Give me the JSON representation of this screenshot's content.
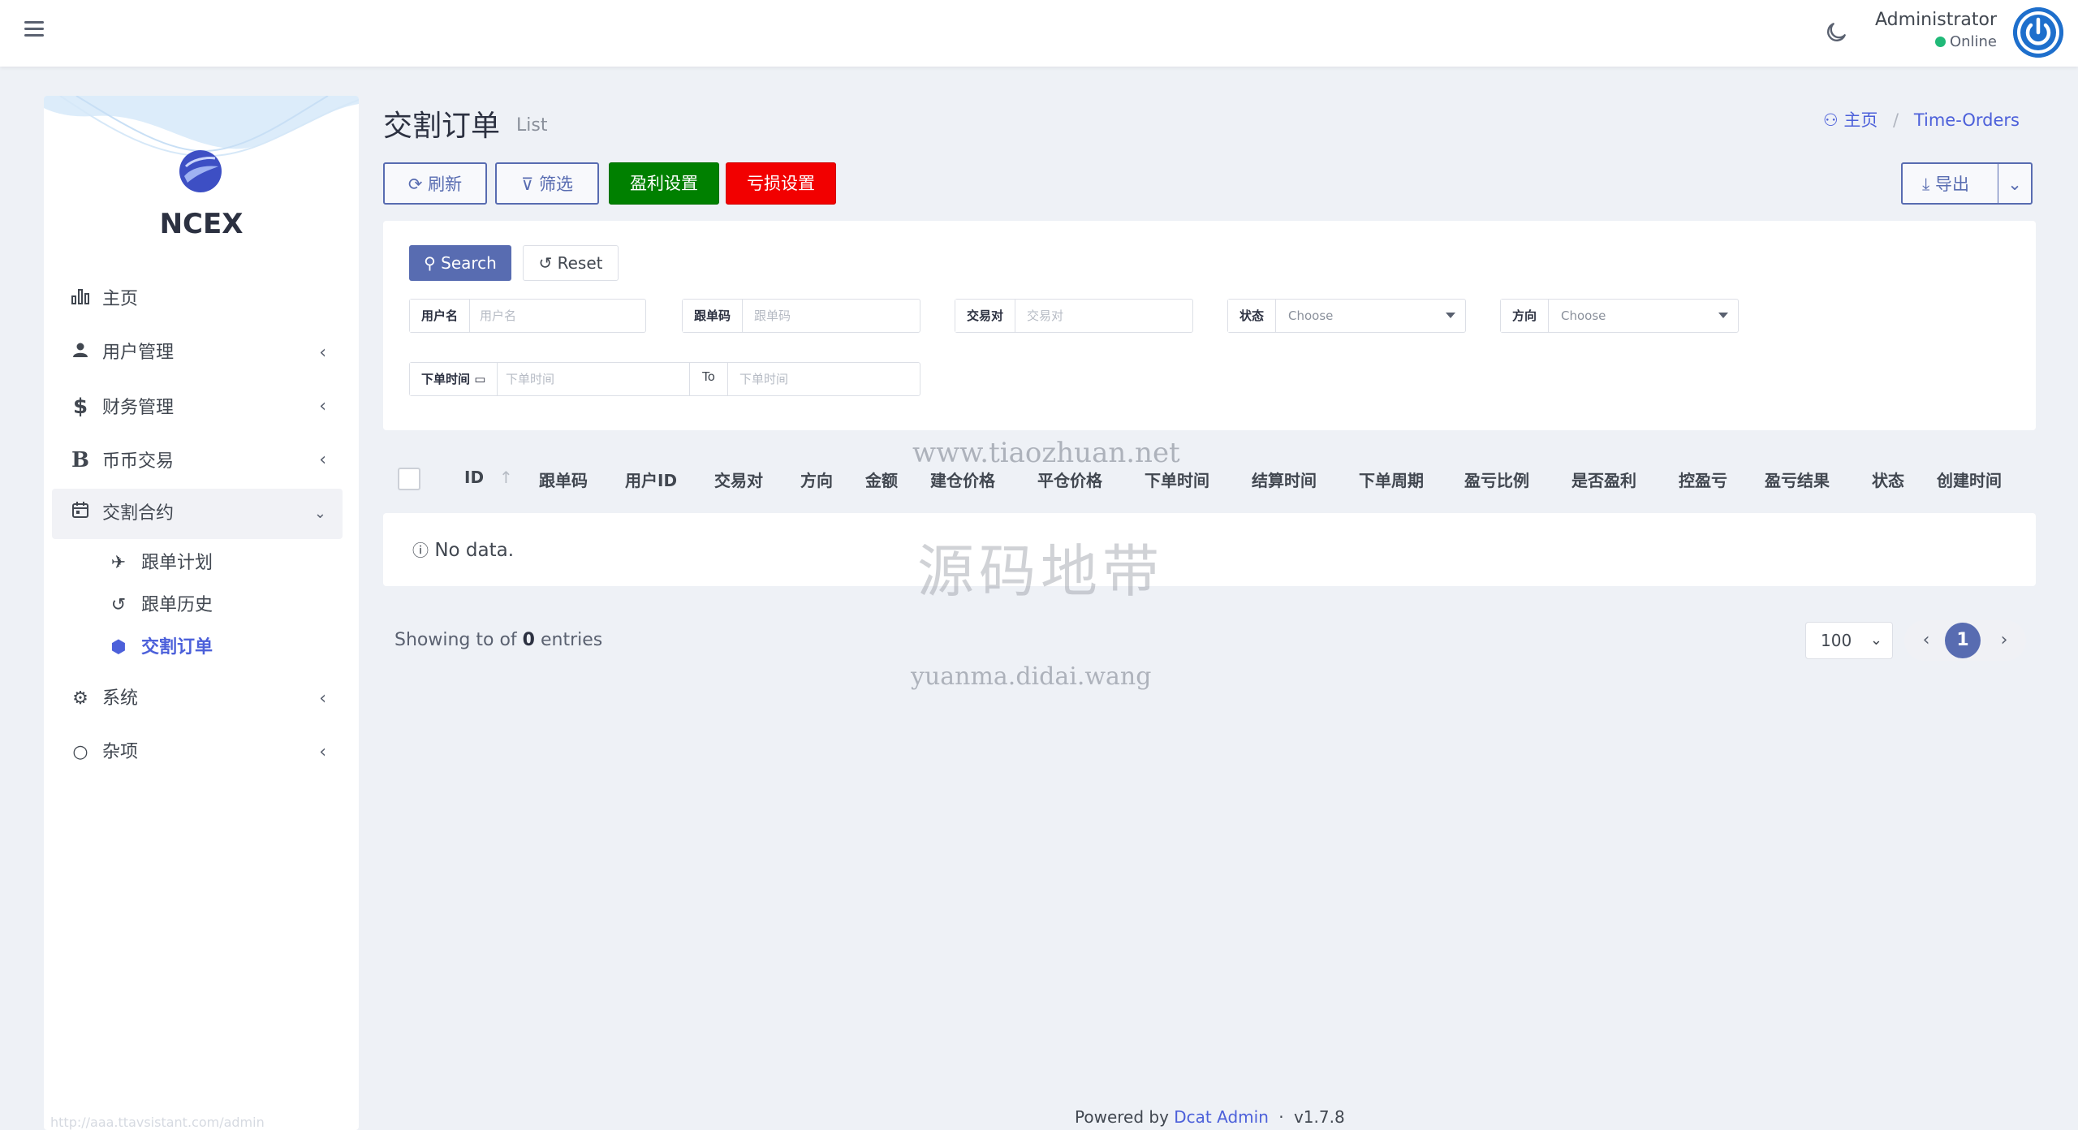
{
  "header": {
    "user_name": "Administrator",
    "user_status": "Online",
    "status_color": "#21b978"
  },
  "sidebar": {
    "brand": "NCEX",
    "items": [
      {
        "label": "主页",
        "icon": "bar-chart-icon"
      },
      {
        "label": "用户管理",
        "icon": "users-icon"
      },
      {
        "label": "财务管理",
        "icon": "dollar-icon"
      },
      {
        "label": "币币交易",
        "icon": "bitcoin-icon"
      },
      {
        "label": "交割合约",
        "icon": "calendar-icon"
      },
      {
        "label": "系统",
        "icon": "gear-icon"
      },
      {
        "label": "杂项",
        "icon": "circle-icon"
      }
    ],
    "subitems": [
      {
        "label": "跟单计划",
        "icon": "plane-icon"
      },
      {
        "label": "跟单历史",
        "icon": "history-icon"
      },
      {
        "label": "交割订单",
        "icon": "hexagon-icon"
      }
    ],
    "footer_url": "http://aaa.ttavsistant.com/admin"
  },
  "page": {
    "title": "交割订单",
    "subtitle": "List",
    "breadcrumb_home": "主页",
    "breadcrumb_current": "Time-Orders"
  },
  "toolbar": {
    "refresh": "刷新",
    "filter": "筛选",
    "profit_settings": "盈利设置",
    "loss_settings": "亏损设置",
    "export": "导出"
  },
  "filter": {
    "search": "Search",
    "reset": "Reset",
    "fields": {
      "username": {
        "label": "用户名",
        "placeholder": "用户名"
      },
      "follow_code": {
        "label": "跟单码",
        "placeholder": "跟单码"
      },
      "pair": {
        "label": "交易对",
        "placeholder": "交易对"
      },
      "status": {
        "label": "状态",
        "value": "Choose"
      },
      "direction": {
        "label": "方向",
        "value": "Choose"
      },
      "order_time": {
        "label": "下单时间",
        "placeholder_from": "下单时间",
        "to": "To",
        "placeholder_to": "下单时间"
      }
    }
  },
  "table": {
    "columns": [
      "ID",
      "跟单码",
      "用户ID",
      "交易对",
      "方向",
      "金额",
      "建仓价格",
      "平仓价格",
      "下单时间",
      "结算时间",
      "下单周期",
      "盈亏比例",
      "是否盈利",
      "控盈亏",
      "盈亏结果",
      "状态",
      "创建时间"
    ],
    "empty_text": "No data."
  },
  "pagination": {
    "showing_prefix": "Showing to of",
    "total": "0",
    "showing_suffix": "entries",
    "per_page": "100",
    "current_page": "1"
  },
  "watermark": {
    "line1": "www.tiaozhuan.net",
    "line2": "源码地带",
    "line3": "yuanma.didai.wang"
  },
  "footer": {
    "powered_by": "Powered by",
    "link": "Dcat Admin",
    "dot": "·",
    "version": "v1.7.8"
  },
  "colors": {
    "primary": "#586cb1",
    "link": "#4c60da",
    "profit_button": "#008000",
    "loss_button": "#f20000"
  }
}
